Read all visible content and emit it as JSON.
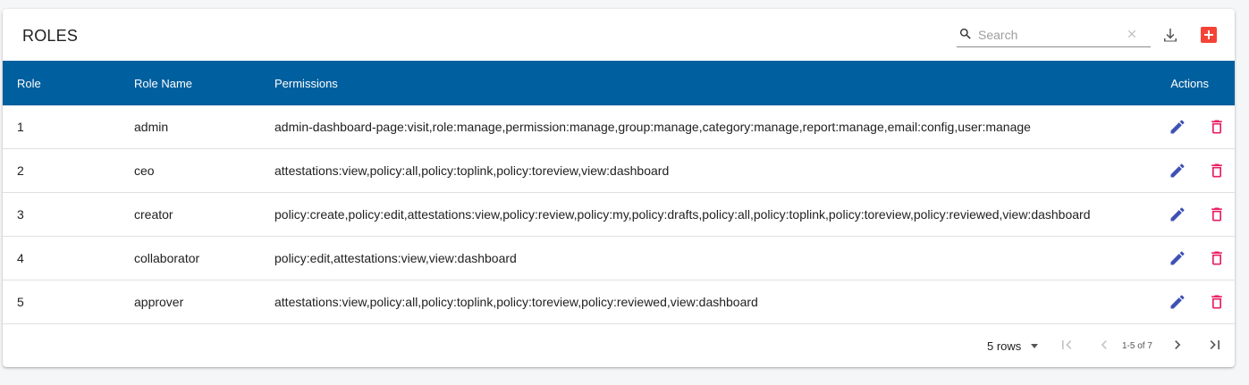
{
  "title": "ROLES",
  "search": {
    "placeholder": "Search"
  },
  "colors": {
    "header_bg": "#005f9e",
    "edit": "#3f51b5",
    "delete": "#e91e63",
    "add": "#f44336"
  },
  "table": {
    "headers": {
      "role": "Role",
      "name": "Role Name",
      "permissions": "Permissions",
      "actions": "Actions"
    },
    "rows": [
      {
        "role": "1",
        "name": "admin",
        "permissions": "admin-dashboard-page:visit,role:manage,permission:manage,group:manage,category:manage,report:manage,email:config,user:manage"
      },
      {
        "role": "2",
        "name": "ceo",
        "permissions": "attestations:view,policy:all,policy:toplink,policy:toreview,view:dashboard"
      },
      {
        "role": "3",
        "name": "creator",
        "permissions": "policy:create,policy:edit,attestations:view,policy:review,policy:my,policy:drafts,policy:all,policy:toplink,policy:toreview,policy:reviewed,view:dashboard"
      },
      {
        "role": "4",
        "name": "collaborator",
        "permissions": "policy:edit,attestations:view,view:dashboard"
      },
      {
        "role": "5",
        "name": "approver",
        "permissions": "attestations:view,policy:all,policy:toplink,policy:toreview,policy:reviewed,view:dashboard"
      }
    ]
  },
  "pagination": {
    "rows_label": "5 rows",
    "range": "1-5 of 7"
  },
  "icons": [
    "search-icon",
    "clear-icon",
    "download-icon",
    "add-icon",
    "edit-icon",
    "delete-icon",
    "first-page-icon",
    "previous-page-icon",
    "next-page-icon",
    "last-page-icon"
  ]
}
